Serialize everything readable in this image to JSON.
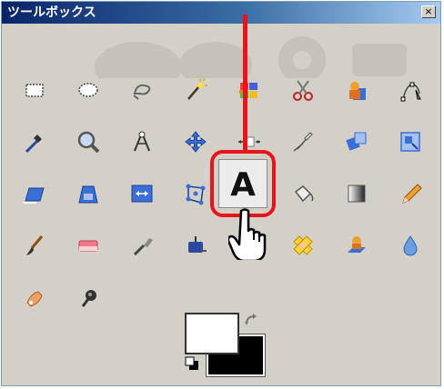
{
  "window": {
    "title": "ツールボックス",
    "close_label": "×"
  },
  "tools": [
    {
      "icon": "rect-select-icon"
    },
    {
      "icon": "ellipse-select-icon"
    },
    {
      "icon": "free-select-icon"
    },
    {
      "icon": "fuzzy-select-icon"
    },
    {
      "icon": "select-by-color-icon"
    },
    {
      "icon": "scissors-select-icon"
    },
    {
      "icon": "foreground-select-icon"
    },
    {
      "icon": "paths-icon"
    },
    {
      "icon": "color-picker-icon"
    },
    {
      "icon": "zoom-icon"
    },
    {
      "icon": "measure-icon"
    },
    {
      "icon": "move-icon"
    },
    {
      "icon": "align-icon"
    },
    {
      "icon": "crop-icon"
    },
    {
      "icon": "rotate-icon"
    },
    {
      "icon": "scale-icon"
    },
    {
      "icon": "shear-icon"
    },
    {
      "icon": "perspective-icon"
    },
    {
      "icon": "flip-icon"
    },
    {
      "icon": "cage-transform-icon"
    },
    {
      "icon": "text-icon"
    },
    {
      "icon": "bucket-fill-icon"
    },
    {
      "icon": "blend-icon"
    },
    {
      "icon": "pencil-icon"
    },
    {
      "icon": "paintbrush-icon"
    },
    {
      "icon": "eraser-icon"
    },
    {
      "icon": "airbrush-icon"
    },
    {
      "icon": "ink-icon"
    },
    {
      "icon": "clone-icon"
    },
    {
      "icon": "heal-icon"
    },
    {
      "icon": "perspective-clone-icon"
    },
    {
      "icon": "blur-sharpen-icon"
    },
    {
      "icon": "smudge-icon"
    },
    {
      "icon": "dodge-burn-icon"
    }
  ],
  "text_tool": {
    "glyph": "A"
  },
  "colors": {
    "foreground": "#ffffff",
    "background": "#000000",
    "highlight": "#e8141b"
  }
}
